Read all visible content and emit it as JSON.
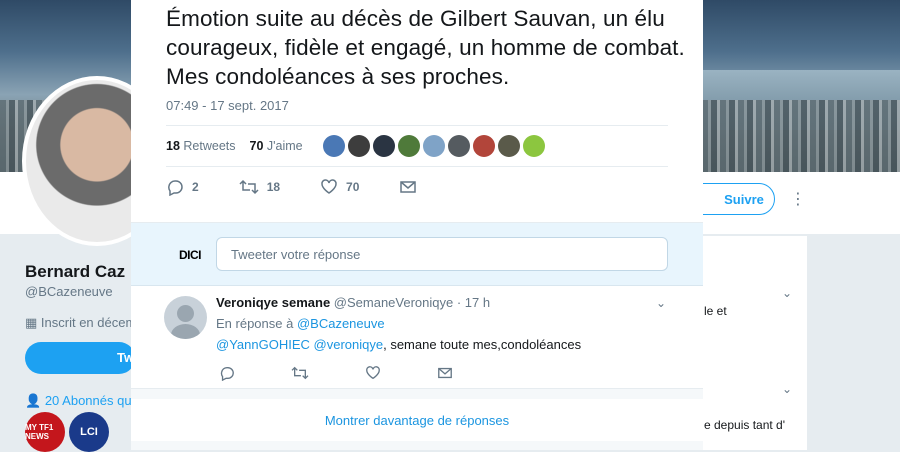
{
  "profile": {
    "name": "Bernard Caz",
    "handle": "@BCazeneuve",
    "joined": "Inscrit en décem",
    "tweet_button": "Tw",
    "followers": "20 Abonnés qu",
    "follow_button": "Suivre",
    "media": [
      "MY TF1 NEWS",
      "LCI"
    ]
  },
  "side_card": {
    "line1": "le et",
    "line2": "e depuis tant d'"
  },
  "tweet": {
    "text": "Émotion suite au décès de Gilbert Sauvan,  un élu courageux, fidèle et engagé, un homme de combat. Mes condoléances à ses proches.",
    "timestamp": "07:49 - 17 sept. 2017",
    "retweets_count": "18",
    "retweets_label": "Retweets",
    "likes_count": "70",
    "likes_label": "J'aime",
    "liker_colors": [
      "#4a78b5",
      "#3d3d3d",
      "#2a3442",
      "#4f7a3a",
      "#7fa3c7",
      "#555b60",
      "#b2453a",
      "#5a5a4a",
      "#8cc63f"
    ],
    "actions": {
      "replies": "2",
      "retweets": "18",
      "likes": "70"
    }
  },
  "reply_box": {
    "avatar_text": "DICI",
    "placeholder": "Tweeter votre réponse"
  },
  "reply": {
    "name": "Veroniqye semane",
    "handle": "@SemaneVeroniqye",
    "time": "· 17 h",
    "in_reply_prefix": "En réponse à",
    "in_reply_to": "@BCazeneuve",
    "mention1": "@YannGOHIEC",
    "mention2": "@veroniqye",
    "body": ", semane toute mes,condoléances"
  },
  "more_replies": "Montrer davantage de réponses",
  "colors": {
    "accent": "#1da1f2",
    "link": "#1b95e0",
    "muted": "#657786"
  }
}
